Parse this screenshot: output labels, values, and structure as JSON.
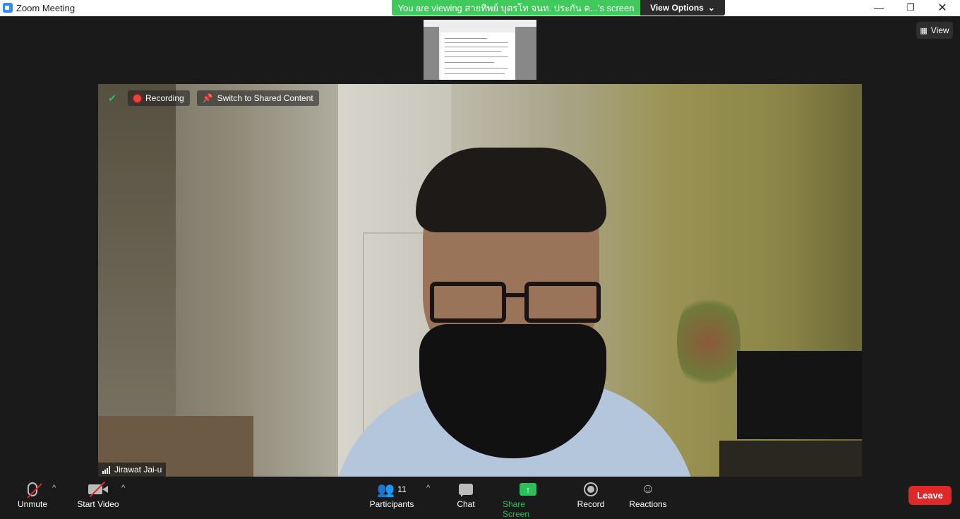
{
  "window": {
    "title": "Zoom Meeting",
    "minimize_icon": "minimize-icon",
    "restore_icon": "restore-icon",
    "close_icon": "close-icon"
  },
  "banner": {
    "text": "You are viewing สายทิพย์ บุตรโท จนท. ประกัน ค...'s screen",
    "color": "#3fca5b"
  },
  "view_options": {
    "label": "View Options",
    "chevron": "⌄"
  },
  "view_button": {
    "label": "View",
    "icon": "grid-icon"
  },
  "video": {
    "security_icon": "shield-check-icon",
    "recording_label": "Recording",
    "switch_label": "Switch to Shared Content",
    "participant_name": "Jirawat Jai-u"
  },
  "toolbar": {
    "unmute_label": "Unmute",
    "start_video_label": "Start Video",
    "participants_label": "Participants",
    "participants_count": "11",
    "chat_label": "Chat",
    "share_label": "Share Screen",
    "record_label": "Record",
    "reactions_label": "Reactions",
    "leave_label": "Leave",
    "caret": "^",
    "leave_color": "#e02828",
    "share_color": "#28c15a"
  }
}
